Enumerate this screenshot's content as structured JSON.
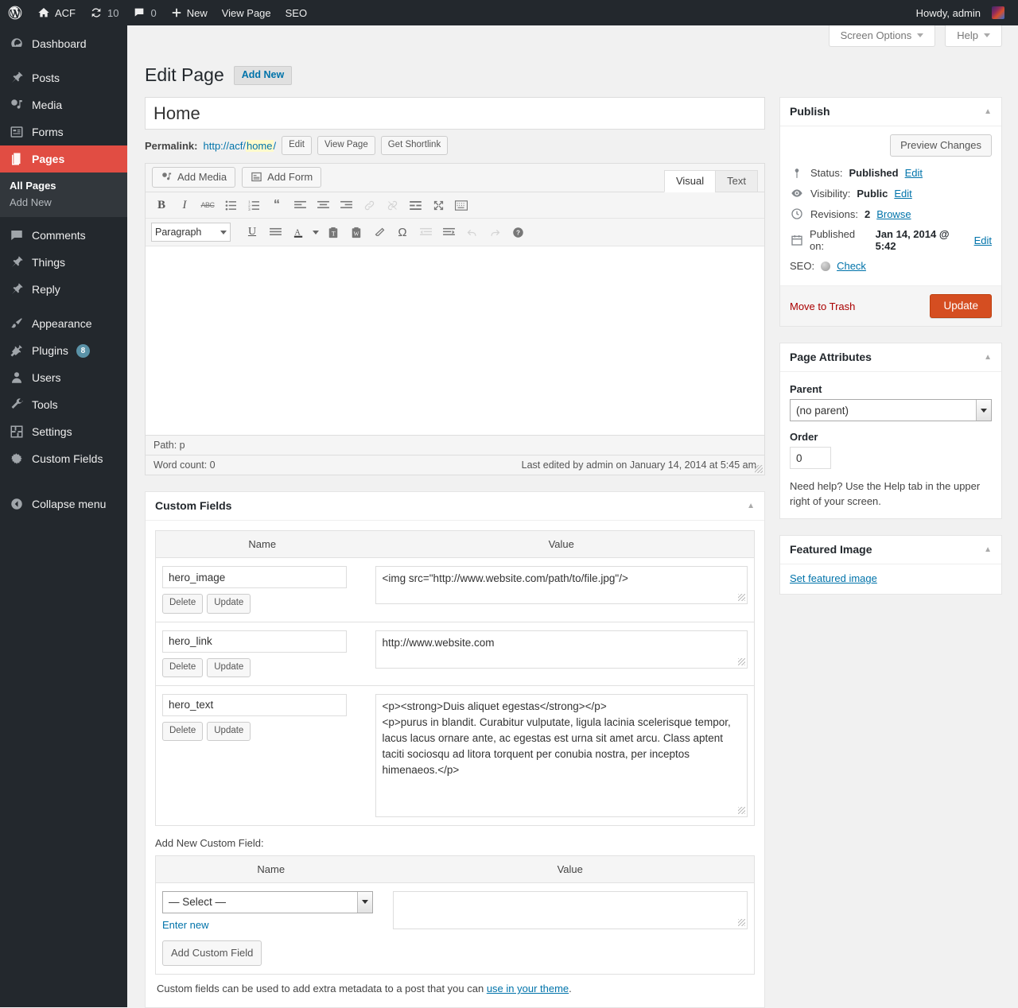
{
  "adminbar": {
    "logo": "wordpress-logo",
    "site_name": "ACF",
    "updates_count": "10",
    "comments_count": "0",
    "new_label": "New",
    "view_page_label": "View Page",
    "seo_label": "SEO",
    "howdy": "Howdy, admin"
  },
  "sidebar": {
    "items": [
      {
        "label": "Dashboard",
        "icon": "dashboard-icon"
      },
      {
        "label": "Posts",
        "icon": "pin-icon"
      },
      {
        "label": "Media",
        "icon": "media-icon"
      },
      {
        "label": "Forms",
        "icon": "forms-icon"
      },
      {
        "label": "Pages",
        "icon": "pages-icon",
        "current": true
      },
      {
        "label": "Comments",
        "icon": "comment-icon"
      },
      {
        "label": "Things",
        "icon": "pin-icon"
      },
      {
        "label": "Reply",
        "icon": "pin-icon"
      },
      {
        "label": "Appearance",
        "icon": "brush-icon"
      },
      {
        "label": "Plugins",
        "icon": "plug-icon",
        "badge": "8"
      },
      {
        "label": "Users",
        "icon": "user-icon"
      },
      {
        "label": "Tools",
        "icon": "wrench-icon"
      },
      {
        "label": "Settings",
        "icon": "settings-icon"
      },
      {
        "label": "Custom Fields",
        "icon": "gear-icon"
      }
    ],
    "submenu": [
      {
        "label": "All Pages",
        "current": true
      },
      {
        "label": "Add New",
        "current": false
      }
    ],
    "collapse_label": "Collapse menu"
  },
  "screen_meta": {
    "screen_options": "Screen Options",
    "help": "Help"
  },
  "header": {
    "title": "Edit Page",
    "add_new": "Add New"
  },
  "post": {
    "title_value": "Home",
    "permalink_label": "Permalink:",
    "permalink_prefix": "http://acf/",
    "permalink_slug": "home",
    "permalink_suffix": "/",
    "edit_btn": "Edit",
    "view_page_btn": "View Page",
    "get_shortlink_btn": "Get Shortlink"
  },
  "editor": {
    "add_media": "Add Media",
    "add_form": "Add Form",
    "tab_visual": "Visual",
    "tab_text": "Text",
    "format_select": "Paragraph",
    "path": "Path: p",
    "word_count": "Word count: 0",
    "last_edited": "Last edited by admin on January 14, 2014 at 5:45 am",
    "toolbar_row1": [
      "bold-icon",
      "italic-icon",
      "strikethrough-icon",
      "unordered-list-icon",
      "ordered-list-icon",
      "blockquote-icon",
      "align-left-icon",
      "align-center-icon",
      "align-right-icon",
      "insert-link-icon",
      "unlink-icon",
      "more-tag-icon",
      "fullscreen-icon",
      "kitchen-sink-icon"
    ],
    "toolbar_row2": [
      "underline-icon",
      "justify-icon",
      "text-color-icon",
      "paste-as-text-icon",
      "paste-from-word-icon",
      "clear-formatting-icon",
      "special-character-icon",
      "outdent-icon",
      "indent-icon",
      "undo-icon",
      "redo-icon",
      "help-icon"
    ]
  },
  "custom_fields": {
    "box_title": "Custom Fields",
    "col_name": "Name",
    "col_value": "Value",
    "rows": [
      {
        "name": "hero_image",
        "value": "<img src=\"http://www.website.com/path/to/file.jpg\"/>",
        "delete": "Delete",
        "update": "Update"
      },
      {
        "name": "hero_link",
        "value": "http://www.website.com",
        "delete": "Delete",
        "update": "Update"
      },
      {
        "name": "hero_text",
        "value": "<p><strong>Duis aliquet egestas</strong></p>\n<p>purus in blandit. Curabitur vulputate, ligula lacinia scelerisque tempor, lacus lacus ornare ante, ac egestas est urna sit amet arcu. Class aptent taciti sociosqu ad litora torquent per conubia nostra, per inceptos himenaeos.</p>",
        "delete": "Delete",
        "update": "Update"
      }
    ],
    "add_new_label": "Add New Custom Field:",
    "add_col_name": "Name",
    "add_col_value": "Value",
    "select_placeholder": "— Select —",
    "enter_new": "Enter new",
    "new_value": "",
    "add_button": "Add Custom Field",
    "footer_text_before": "Custom fields can be used to add extra metadata to a post that you can ",
    "footer_link": "use in your theme",
    "footer_text_after": "."
  },
  "publish": {
    "title": "Publish",
    "preview_changes": "Preview Changes",
    "status_label": "Status:",
    "status_value": "Published",
    "status_edit": "Edit",
    "visibility_label": "Visibility:",
    "visibility_value": "Public",
    "visibility_edit": "Edit",
    "revisions_label": "Revisions:",
    "revisions_value": "2",
    "revisions_browse": "Browse",
    "published_label": "Published on:",
    "published_value": "Jan 14, 2014 @ 5:42",
    "published_edit": "Edit",
    "seo_label": "SEO:",
    "seo_check": "Check",
    "move_to_trash": "Move to Trash",
    "update_button": "Update"
  },
  "page_attributes": {
    "title": "Page Attributes",
    "parent_label": "Parent",
    "parent_value": "(no parent)",
    "order_label": "Order",
    "order_value": "0",
    "help_note": "Need help? Use the Help tab in the upper right of your screen."
  },
  "featured_image": {
    "title": "Featured Image",
    "set_link": "Set featured image"
  },
  "colors": {
    "admin_bar": "#23282d",
    "sidebar": "#23282d",
    "current_menu": "#e14d43",
    "link": "#0073aa",
    "primary_button": "#d54e21",
    "badge": "#5a92a7",
    "trash": "#a00",
    "highlight": "#fffbcc"
  }
}
